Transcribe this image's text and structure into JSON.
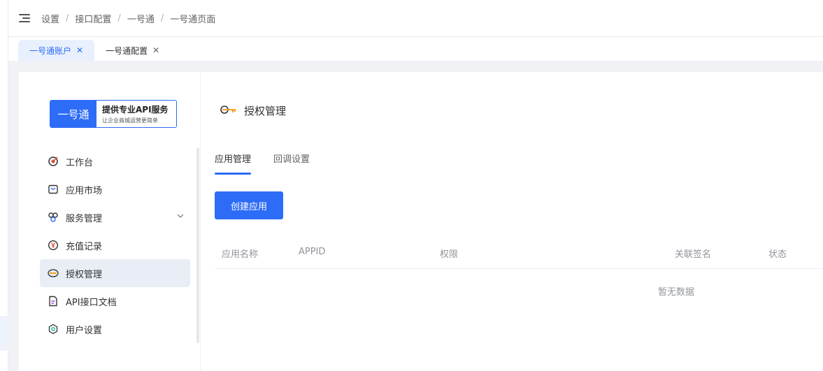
{
  "breadcrumb": [
    "设置",
    "接口配置",
    "一号通",
    "一号通页面"
  ],
  "breadcrumb_separator": "/",
  "tabs": [
    {
      "label": "一号通账户",
      "active": true
    },
    {
      "label": "一号通配置",
      "active": false
    }
  ],
  "brand": {
    "name": "一号通",
    "tagline": "提供专业API服务",
    "subline": "让企业商城运营更简单"
  },
  "sidebar": {
    "items": [
      {
        "label": "工作台",
        "icon": "target-icon"
      },
      {
        "label": "应用市场",
        "icon": "store-icon"
      },
      {
        "label": "服务管理",
        "icon": "services-icon",
        "expandable": true
      },
      {
        "label": "充值记录",
        "icon": "yen-coin-icon"
      },
      {
        "label": "授权管理",
        "icon": "key-icon",
        "active": true
      },
      {
        "label": "API接口文档",
        "icon": "document-icon"
      },
      {
        "label": "用户设置",
        "icon": "hexagon-settings-icon"
      }
    ]
  },
  "page": {
    "title": "授权管理",
    "subtabs": [
      {
        "label": "应用管理",
        "active": true
      },
      {
        "label": "回调设置",
        "active": false
      }
    ],
    "create_button": "创建应用",
    "table": {
      "columns": [
        "应用名称",
        "APPID",
        "权限",
        "关联签名",
        "状态"
      ],
      "empty_text": "暂无数据"
    }
  },
  "colors": {
    "primary": "#2d6cf6",
    "active_bg": "#e9edf5"
  }
}
